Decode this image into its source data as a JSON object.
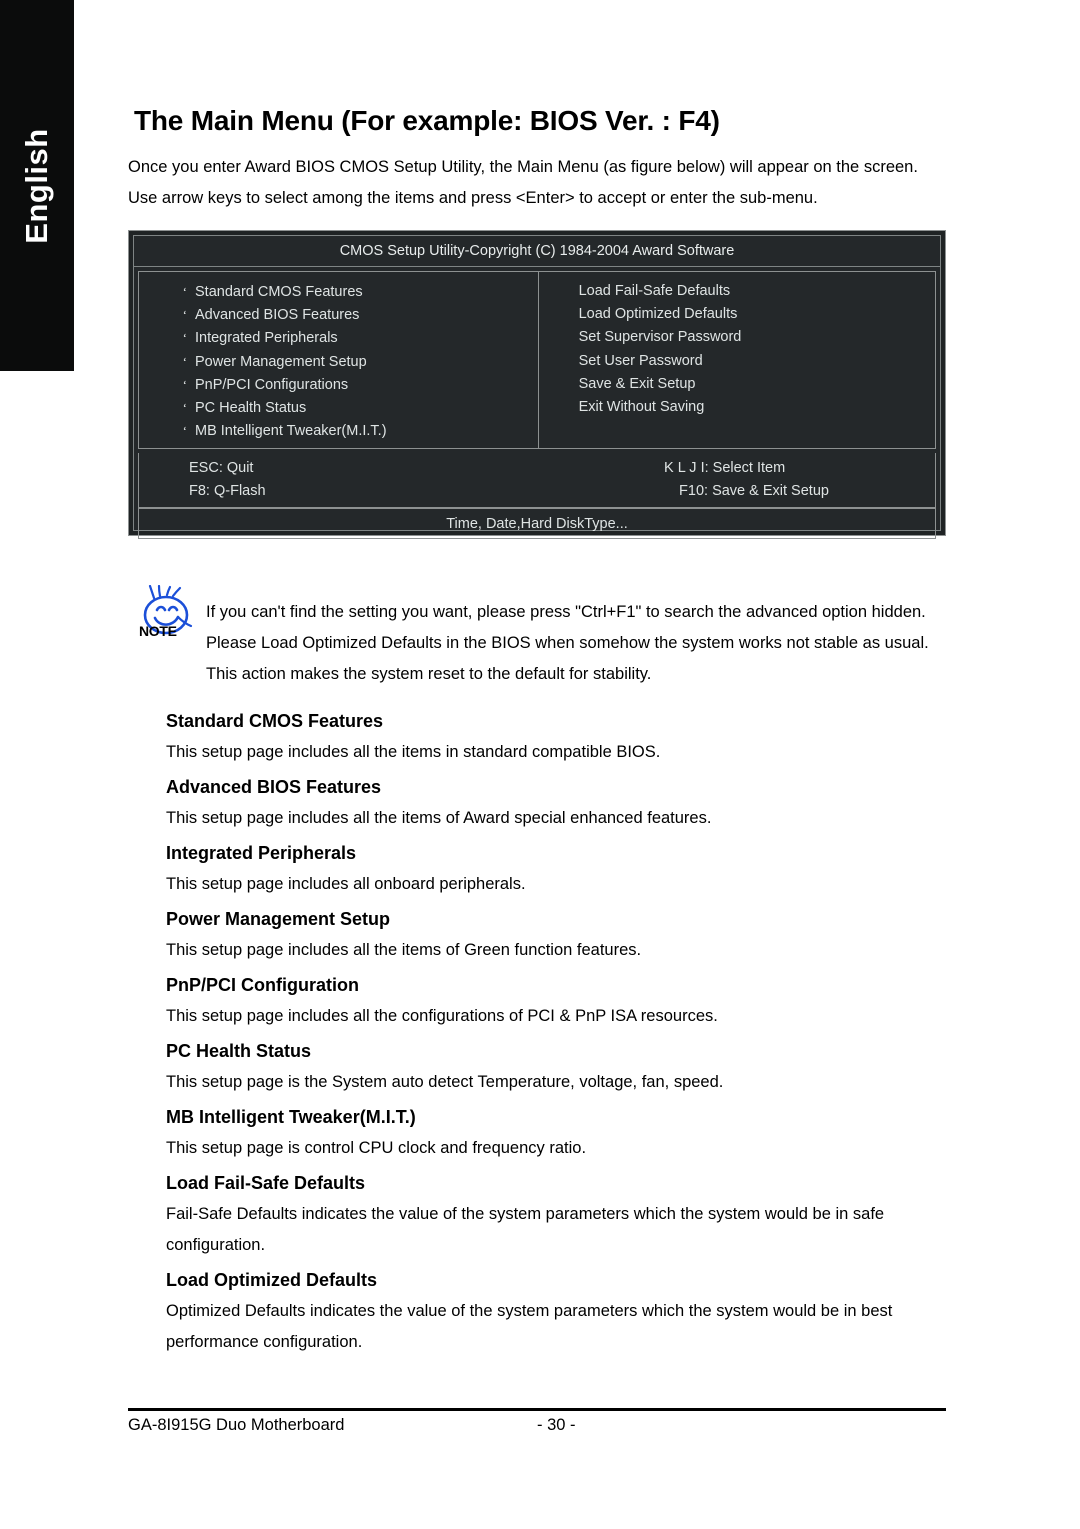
{
  "sidebar": {
    "language_tab": "English"
  },
  "header": {
    "title": "The Main Menu (For example: BIOS Ver. : F4)",
    "intro_line1": "Once you enter Award BIOS CMOS Setup Utility, the Main Menu (as figure below) will appear on the screen.",
    "intro_line2": "Use arrow keys to select among the items and press <Enter> to accept or enter the sub-menu."
  },
  "bios_screen": {
    "title": "CMOS Setup Utility-Copyright (C) 1984-2004 Award Software",
    "bullet_glyph": "‘",
    "left_items": [
      "Standard CMOS Features",
      "Advanced BIOS Features",
      "Integrated Peripherals",
      "Power Management Setup",
      "PnP/PCI Configurations",
      "PC Health Status",
      "MB Intelligent Tweaker(M.I.T.)"
    ],
    "right_items": [
      "Load Fail-Safe Defaults",
      "Load Optimized Defaults",
      "Set Supervisor Password",
      "Set User Password",
      "Save & Exit Setup",
      "Exit Without Saving"
    ],
    "key_row1_left": "ESC: Quit",
    "key_row1_right": "K L J I: Select Item",
    "key_row2_left": "F8: Q-Flash",
    "key_row2_right": "F10: Save & Exit Setup",
    "status_line": "Time, Date,Hard DiskType..."
  },
  "note": {
    "label": "NOTE",
    "line1": "If you can't find the setting you want, please press \"Ctrl+F1\" to search the advanced option hidden.",
    "line2": "Please Load Optimized Defaults in the BIOS when somehow the system works not stable as usual.",
    "line3": "This action makes the system reset to the default for stability."
  },
  "sections": [
    {
      "heading": "Standard CMOS Features",
      "body": "This setup page includes all the items in standard compatible BIOS."
    },
    {
      "heading": "Advanced BIOS Features",
      "body": "This setup page includes all the items of Award special enhanced features."
    },
    {
      "heading": "Integrated Peripherals",
      "body": "This setup page includes all onboard peripherals."
    },
    {
      "heading": "Power Management Setup",
      "body": "This setup page includes all the items of Green function features."
    },
    {
      "heading": "PnP/PCI Configuration",
      "body": "This setup page includes all the configurations of PCI & PnP ISA resources."
    },
    {
      "heading": "PC Health Status",
      "body": "This setup page is the System auto detect Temperature, voltage, fan, speed."
    },
    {
      "heading": "MB Intelligent Tweaker(M.I.T.)",
      "body": "This setup page is control CPU clock and frequency ratio."
    },
    {
      "heading": "Load Fail-Safe Defaults",
      "body": "Fail-Safe Defaults indicates the value of the system parameters which the system would be in safe configuration."
    },
    {
      "heading": "Load Optimized Defaults",
      "body": "Optimized Defaults indicates the value of the system parameters which the system would be in best performance configuration."
    }
  ],
  "footer": {
    "product": "GA-8I915G Duo Motherboard",
    "page_number": "- 30 -"
  },
  "colors": {
    "tab_background": "#0b0c0c",
    "bios_background": "#24282a",
    "bios_border": "#8d9191",
    "bios_text": "#dfe4e4",
    "note_icon": "#1b4fd8"
  }
}
